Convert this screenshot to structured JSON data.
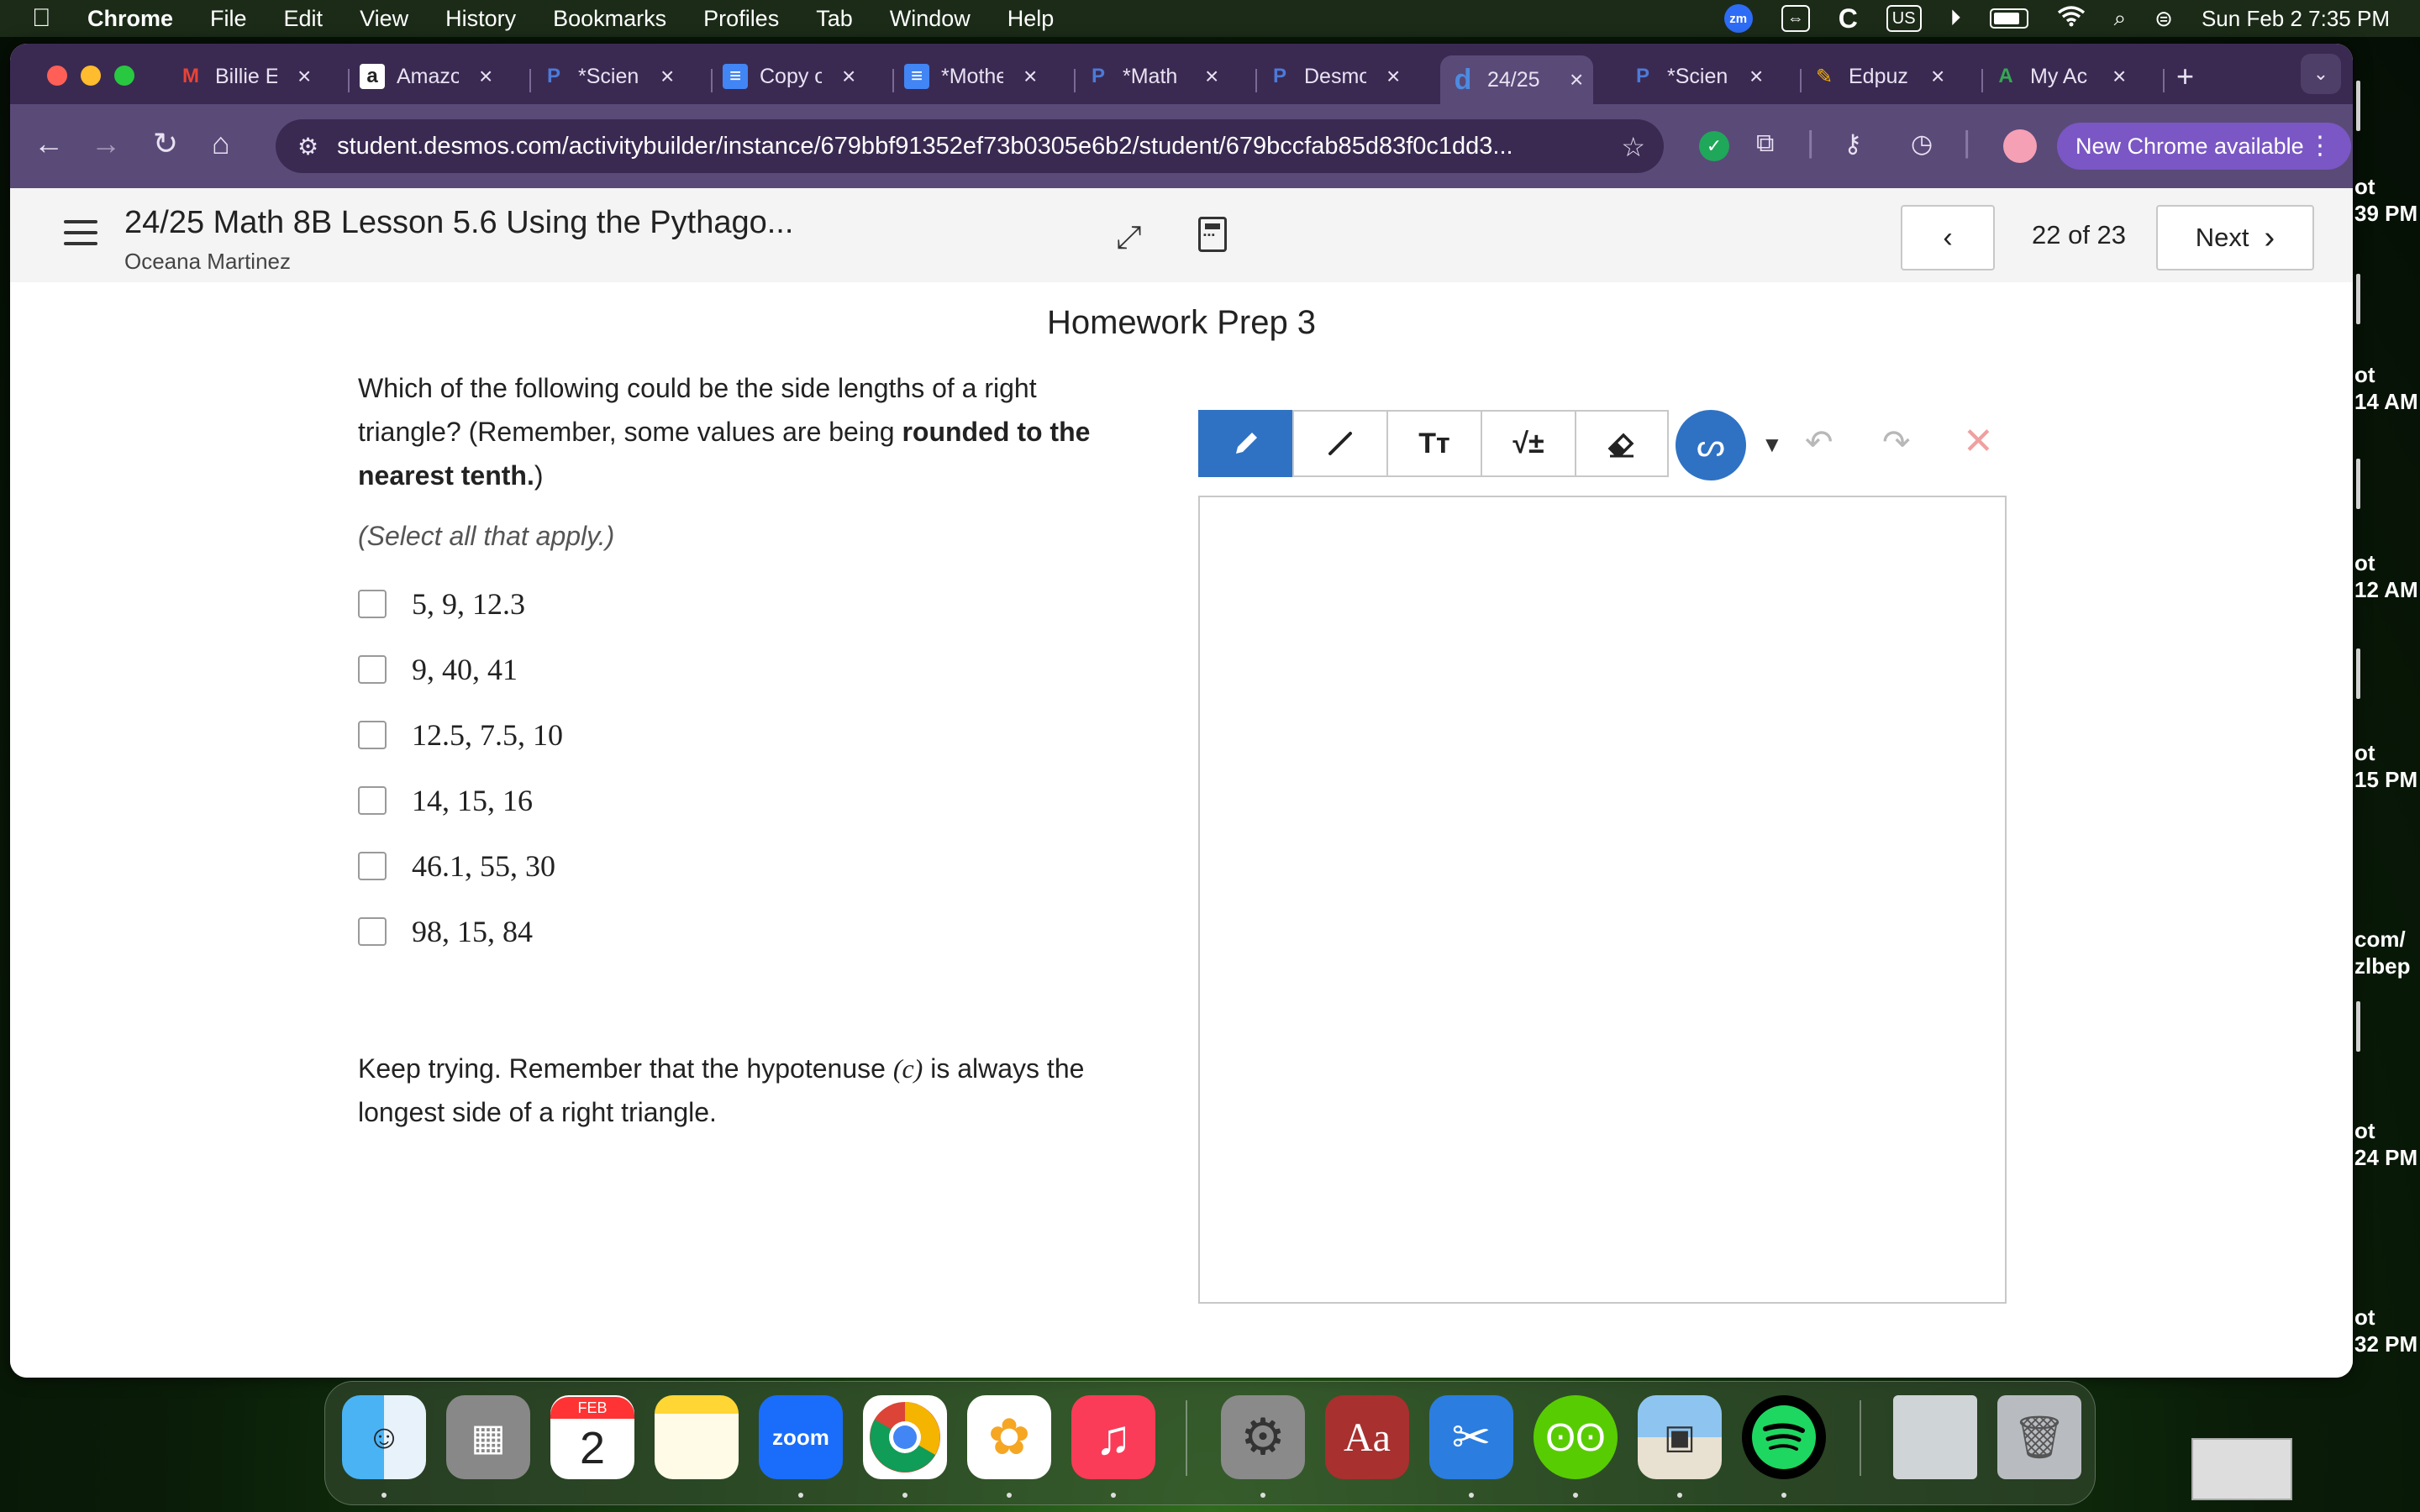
{
  "menubar": {
    "apple_icon": "apple-icon",
    "items": [
      "Chrome",
      "File",
      "Edit",
      "View",
      "History",
      "Bookmarks",
      "Profiles",
      "Tab",
      "Window",
      "Help"
    ],
    "zoom_badge": "zm",
    "c_label": "C",
    "input_source": "US",
    "clock": "Sun Feb 2  7:35 PM"
  },
  "tabs": [
    {
      "title": "Billie E",
      "icon_glyph": "M",
      "icon_color": "#ea4335"
    },
    {
      "title": "Amazo",
      "icon_glyph": "a",
      "icon_color": "#ffffff"
    },
    {
      "title": "*Scien",
      "icon_glyph": "P",
      "icon_color": "#4c7bd9"
    },
    {
      "title": "Copy o",
      "icon_glyph": "≡",
      "icon_color": "#4285f4"
    },
    {
      "title": "*Mothe",
      "icon_glyph": "≡",
      "icon_color": "#4285f4"
    },
    {
      "title": "*Math",
      "icon_glyph": "P",
      "icon_color": "#4c7bd9"
    },
    {
      "title": "Desmo",
      "icon_glyph": "P",
      "icon_color": "#4c7bd9"
    },
    {
      "title": "24/25",
      "icon_glyph": "d",
      "icon_color": "#4c8be0"
    },
    {
      "title": "*Scien",
      "icon_glyph": "P",
      "icon_color": "#4c7bd9"
    },
    {
      "title": "Edpuz",
      "icon_glyph": "✎",
      "icon_color": "#f5b400"
    },
    {
      "title": "My Ac",
      "icon_glyph": "A",
      "icon_color": "#34a853"
    }
  ],
  "toolbar": {
    "url": "student.desmos.com/activitybuilder/instance/679bbf91352ef73b0305e6b2/student/679bccfab85d83f0c1dd3...",
    "new_chrome_label": "New Chrome available"
  },
  "app": {
    "lesson_title": "24/25 Math 8B Lesson 5.6 Using the Pythago...",
    "student_name": "Oceana Martinez",
    "page_counter": "22 of 23",
    "next_label": "Next"
  },
  "screen": {
    "title": "Homework Prep 3",
    "question_part1": "Which of the following could be the side lengths of a right triangle?  (Remember, some values are being ",
    "question_bold": "rounded to the nearest tenth.",
    "question_part2": ")",
    "instruction": "(Select all that apply.)",
    "choices": [
      "5, 9, 12.3",
      "9, 40, 41",
      "12.5, 7.5, 10",
      "14, 15, 16",
      "46.1, 55, 30",
      "98, 15, 84"
    ],
    "feedback_part1": "Keep trying.  Remember that the hypotenuse ",
    "feedback_var": "(c)",
    "feedback_part2": " is always the longest side of a right triangle."
  },
  "sketch": {
    "text_tool_label": "Tт",
    "math_tool_label": "√±",
    "active_color": "#2f72c4"
  },
  "background_windows": [
    {
      "line1": "ot",
      "line2": "39 PM"
    },
    {
      "line1": "ot",
      "line2": "14 AM"
    },
    {
      "line1": "ot",
      "line2": "12 AM"
    },
    {
      "line1": "ot",
      "line2": "15 PM"
    },
    {
      "line1": "com/",
      "line2": "zlbep"
    },
    {
      "line1": "ot",
      "line2": "24 PM"
    },
    {
      "line1": "ot",
      "line2": "32 PM"
    }
  ],
  "dock": {
    "calendar_month": "FEB",
    "calendar_day": "2",
    "zoom_label": "zoom",
    "dictionary_label": "Aa"
  }
}
